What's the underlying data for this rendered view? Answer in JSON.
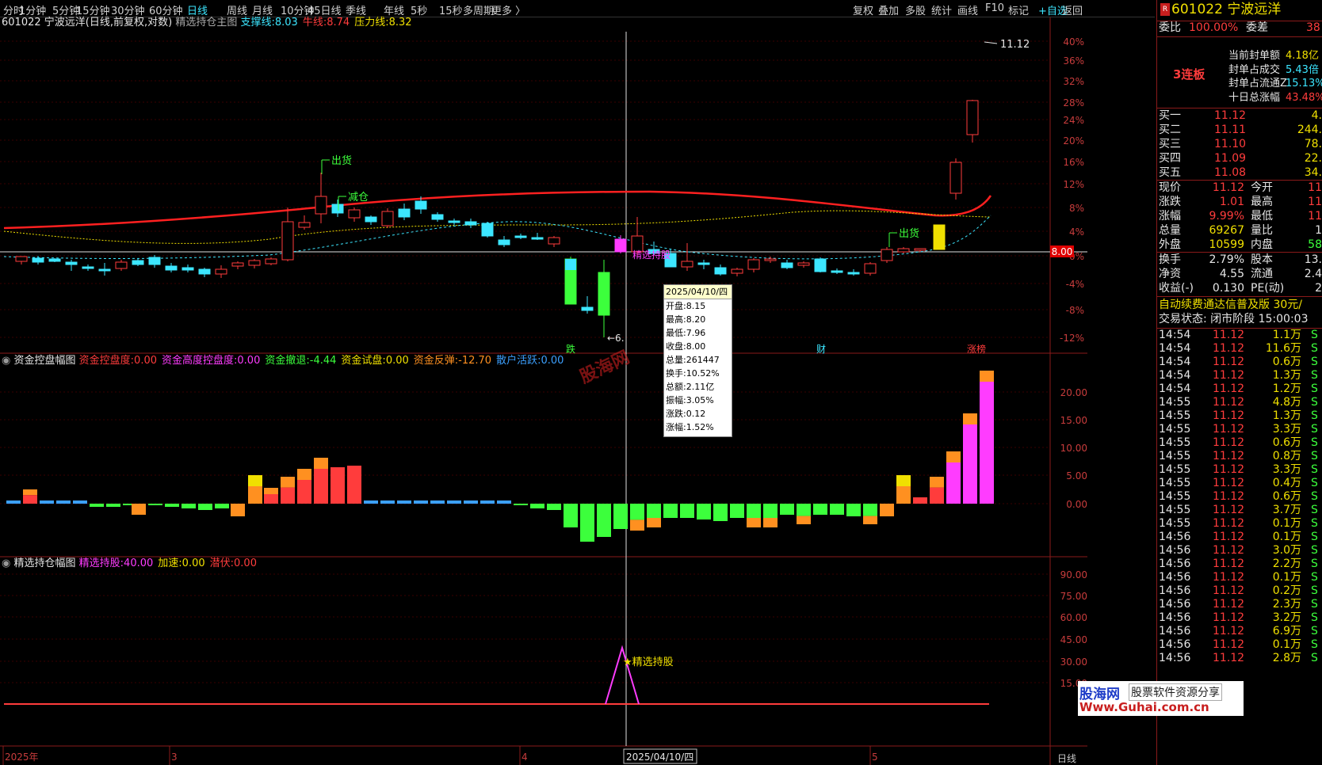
{
  "toolbar": {
    "periods": [
      "分时",
      "1分钟",
      "5分钟",
      "15分钟",
      "30分钟",
      "60分钟",
      "日线",
      "周线",
      "月线",
      "10分钟",
      "45日线",
      "季线",
      "年线",
      "5秒",
      "15秒",
      "多周期",
      "更多 〉"
    ],
    "active": "日线",
    "right": [
      "复权",
      "叠加",
      "多股",
      "统计",
      "画线",
      "F10",
      "标记",
      "+自选",
      "返回"
    ]
  },
  "main": {
    "title": "601022 宁波远洋(日线,前复权,对数)",
    "indicator": "精选持仓主图",
    "labels": [
      {
        "name": "支撑线",
        "value": "8.03",
        "color": "#3ce6ff"
      },
      {
        "name": "牛线",
        "value": "8.74",
        "color": "#ff3c3c"
      },
      {
        "name": "压力线",
        "value": "8.32",
        "color": "#f0e000"
      }
    ],
    "price_label": "8.00",
    "max_label": "11.12",
    "min_label": "6.",
    "signals": [
      "出货",
      "减仓",
      "出货",
      "精选持股"
    ],
    "markers": [
      "跌",
      "财",
      "涨榜"
    ],
    "pct_axis": [
      "40%",
      "36%",
      "32%",
      "28%",
      "24%",
      "20%",
      "16%",
      "12%",
      "8%",
      "4%",
      "0%",
      "-4%",
      "-8%",
      "-12%"
    ]
  },
  "panel2": {
    "title": "资金控盘幅图",
    "labels": [
      {
        "name": "资金控盘度",
        "value": "0.00",
        "color": "#ff3c3c"
      },
      {
        "name": "资金高度控盘度",
        "value": "0.00",
        "color": "#ff3cff"
      },
      {
        "name": "资金撤退",
        "value": "-4.44",
        "color": "#3cff3c"
      },
      {
        "name": "资金试盘",
        "value": "0.00",
        "color": "#f0e000"
      },
      {
        "name": "资金反弹",
        "value": "-12.70",
        "color": "#ff9020"
      },
      {
        "name": "散户活跃",
        "value": "0.00",
        "color": "#3ca0ff"
      }
    ],
    "axis": [
      "20.00",
      "15.00",
      "10.00",
      "5.00",
      "0.00"
    ],
    "watermark": "股海网"
  },
  "panel3": {
    "title": "精选持仓幅图",
    "labels": [
      {
        "name": "精选持股",
        "value": "40.00",
        "color": "#ff3cff"
      },
      {
        "name": "加速",
        "value": "0.00",
        "color": "#f0e000"
      },
      {
        "name": "潜伏",
        "value": "0.00",
        "color": "#ff3c3c"
      }
    ],
    "signal": "精选持股",
    "axis": [
      "90.00",
      "75.00",
      "60.00",
      "45.00",
      "30.00",
      "15.00"
    ]
  },
  "xaxis": {
    "labels": [
      "2025年",
      "3",
      "4",
      "5"
    ],
    "cursor_date": "2025/04/10/四",
    "period": "日线"
  },
  "tooltip": {
    "header": "2025/04/10/四",
    "rows": [
      "开盘:8.15",
      "最高:8.20",
      "最低:7.96",
      "收盘:8.00",
      "总量:261447",
      "换手:10.52%",
      "总额:2.11亿",
      "振幅:3.05%",
      "涨跌:0.12",
      "涨幅:1.52%"
    ]
  },
  "right": {
    "code": "601022",
    "name": "宁波远洋",
    "weibi_label": "委比",
    "weibi": "100.00%",
    "weicha_label": "委差",
    "weicha": "38",
    "lianban": "3连板",
    "seal": [
      [
        "当前封单额",
        "4.18亿"
      ],
      [
        "封单占成交",
        "5.43倍"
      ],
      [
        "封单占流通Z",
        "15.13%"
      ],
      [
        "十日总涨幅",
        "43.48%"
      ]
    ],
    "buy": [
      [
        "买一",
        "11.12",
        "4."
      ],
      [
        "买二",
        "11.11",
        "244."
      ],
      [
        "买三",
        "11.10",
        "78."
      ],
      [
        "买四",
        "11.09",
        "22."
      ],
      [
        "买五",
        "11.08",
        "34."
      ]
    ],
    "quote": [
      [
        "现价",
        "11.12",
        "今开",
        "11"
      ],
      [
        "涨跌",
        "1.01",
        "最高",
        "11"
      ],
      [
        "涨幅",
        "9.99%",
        "最低",
        "11"
      ],
      [
        "总量",
        "69267",
        "量比",
        "1"
      ],
      [
        "外盘",
        "10599",
        "内盘",
        "58"
      ]
    ],
    "stats": [
      [
        "换手",
        "2.79%",
        "股本",
        "13."
      ],
      [
        "净资",
        "4.55",
        "流通",
        "2.4"
      ],
      [
        "收益(-)",
        "0.130",
        "PE(动)",
        "2"
      ]
    ],
    "ad": "自动续费通达信普及版",
    "ad_price": "30元/",
    "trade_state": "交易状态: 闭市阶段 15:00:03",
    "ticks": [
      [
        "14:54",
        "11.12",
        "1.1万"
      ],
      [
        "14:54",
        "11.12",
        "11.6万"
      ],
      [
        "14:54",
        "11.12",
        "0.6万"
      ],
      [
        "14:54",
        "11.12",
        "1.3万"
      ],
      [
        "14:54",
        "11.12",
        "1.2万"
      ],
      [
        "14:55",
        "11.12",
        "4.8万"
      ],
      [
        "14:55",
        "11.12",
        "1.3万"
      ],
      [
        "14:55",
        "11.12",
        "3.3万"
      ],
      [
        "14:55",
        "11.12",
        "0.6万"
      ],
      [
        "14:55",
        "11.12",
        "0.8万"
      ],
      [
        "14:55",
        "11.12",
        "3.3万"
      ],
      [
        "14:55",
        "11.12",
        "0.4万"
      ],
      [
        "14:55",
        "11.12",
        "0.6万"
      ],
      [
        "14:55",
        "11.12",
        "3.7万"
      ],
      [
        "14:55",
        "11.12",
        "0.1万"
      ],
      [
        "14:56",
        "11.12",
        "0.1万"
      ],
      [
        "14:56",
        "11.12",
        "3.0万"
      ],
      [
        "14:56",
        "11.12",
        "2.2万"
      ],
      [
        "14:56",
        "11.12",
        "0.1万"
      ],
      [
        "14:56",
        "11.12",
        "0.2万"
      ],
      [
        "14:56",
        "11.12",
        "2.3万"
      ],
      [
        "14:56",
        "11.12",
        "3.2万"
      ],
      [
        "14:56",
        "11.12",
        "6.9万"
      ],
      [
        "14:56",
        "11.12",
        "0.1万"
      ],
      [
        "14:56",
        "11.12",
        "2.8万"
      ]
    ],
    "tick_flag": "S",
    "logo": "股海网",
    "logo_sub": "股票软件资源分享",
    "logo_url": "Www.Guhai.com.cn"
  },
  "colors": {
    "up": "#ff3c3c",
    "down": "#3ce6ff",
    "bg": "#000000",
    "grid": "#3a0000"
  }
}
